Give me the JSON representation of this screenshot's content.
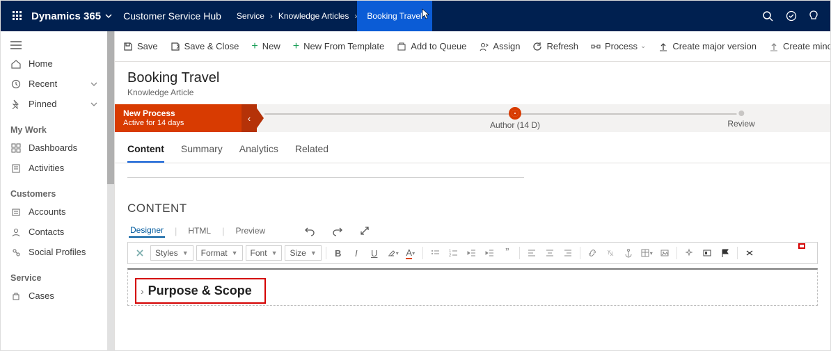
{
  "topnav": {
    "brand": "Dynamics 365",
    "hub": "Customer Service Hub",
    "crumbs": {
      "c1": "Service",
      "c2": "Knowledge Articles",
      "c3": "Booking Travel"
    }
  },
  "sidebar": {
    "home": "Home",
    "recent": "Recent",
    "pinned": "Pinned",
    "h_mywork": "My Work",
    "dashboards": "Dashboards",
    "activities": "Activities",
    "h_customers": "Customers",
    "accounts": "Accounts",
    "contacts": "Contacts",
    "social": "Social Profiles",
    "h_service": "Service",
    "cases": "Cases"
  },
  "cmd": {
    "save": "Save",
    "saveclose": "Save & Close",
    "new": "New",
    "newtpl": "New From Template",
    "queue": "Add to Queue",
    "assign": "Assign",
    "refresh": "Refresh",
    "process": "Process",
    "major": "Create major version",
    "minor": "Create minor"
  },
  "record": {
    "title": "Booking Travel",
    "subtitle": "Knowledge Article"
  },
  "process": {
    "title": "New Process",
    "sub": "Active for 14 days",
    "stage1": "Author  (14 D)",
    "stage2": "Review"
  },
  "tabs": {
    "content": "Content",
    "summary": "Summary",
    "analytics": "Analytics",
    "related": "Related"
  },
  "editor": {
    "section_title": "CONTENT",
    "designer": "Designer",
    "html": "HTML",
    "preview": "Preview",
    "styles": "Styles",
    "format": "Format",
    "font": "Font",
    "size": "Size",
    "heading": "Purpose & Scope"
  }
}
